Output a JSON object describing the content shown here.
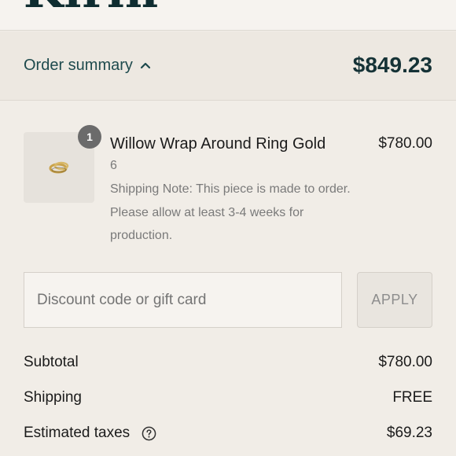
{
  "brand": {
    "logo_text": "Kirin"
  },
  "summary": {
    "toggle_label": "Order summary",
    "total": "$849.23",
    "chevron_icon": "chevron-up-icon"
  },
  "line_item": {
    "quantity_badge": "1",
    "name": "Willow Wrap Around Ring Gold",
    "variant": "6",
    "note": "Shipping Note: This piece is made to order. Please allow at least 3-4 weeks for production.",
    "price": "$780.00",
    "thumbnail_icon": "ring-icon"
  },
  "discount": {
    "placeholder": "Discount code or gift card",
    "value": "",
    "apply_label": "APPLY"
  },
  "totals": [
    {
      "label": "Subtotal",
      "value": "$780.00"
    },
    {
      "label": "Shipping",
      "value": "FREE"
    },
    {
      "label": "Estimated taxes",
      "value": "$69.23",
      "help_icon": "question-circle-icon"
    }
  ],
  "colors": {
    "page_bg": "#f1ede7",
    "summary_bg": "#ede8e1",
    "accent_teal": "#1e4a4d",
    "total_color": "#153236",
    "muted_text": "#7a7a7a",
    "badge_bg": "#6b6b6b"
  }
}
